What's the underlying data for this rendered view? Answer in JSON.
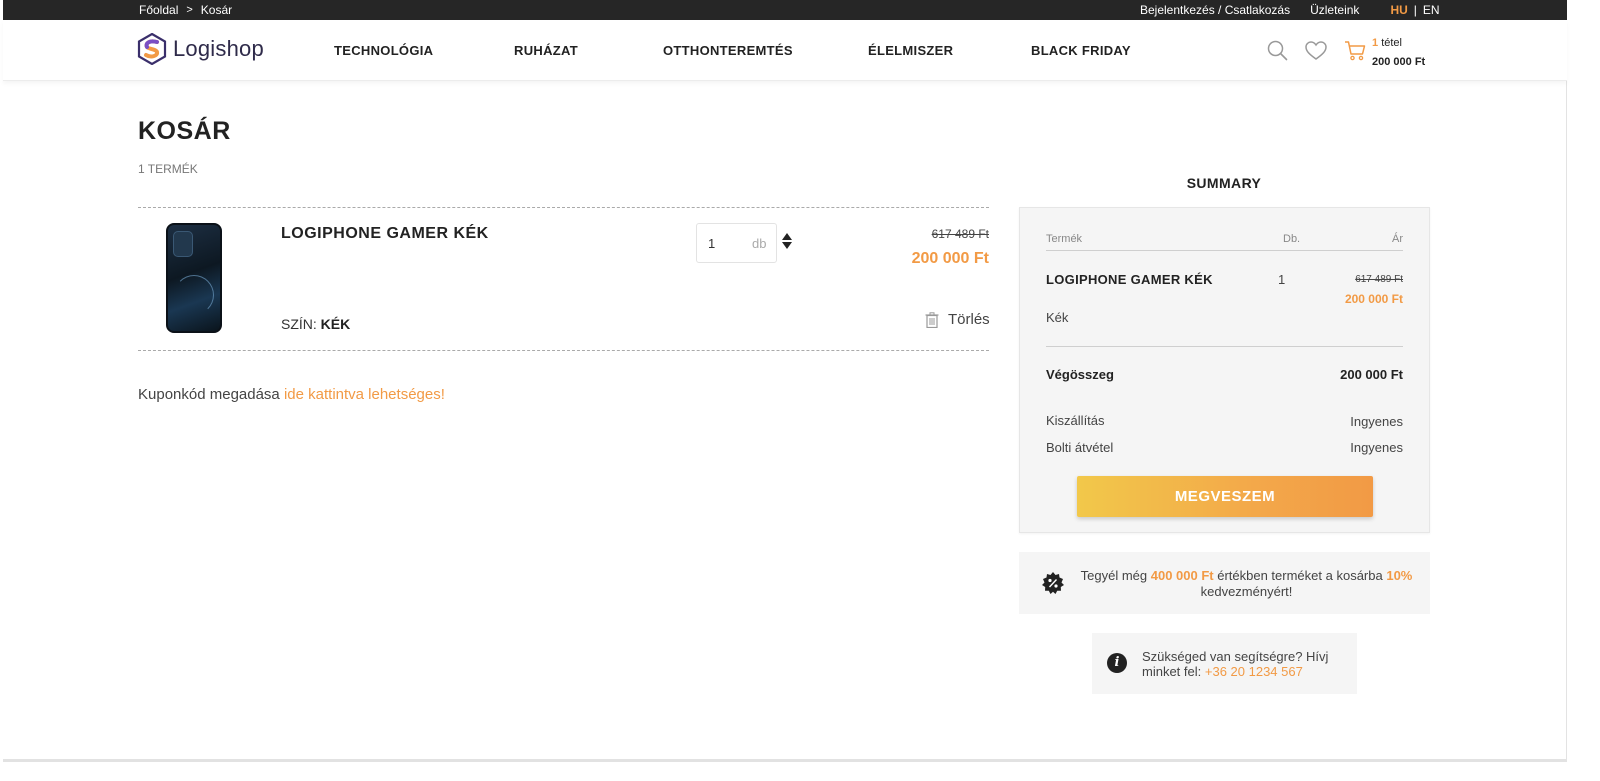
{
  "topbar": {
    "breadcrumb": [
      {
        "label": "Főoldal"
      },
      {
        "label": "Kosár"
      }
    ],
    "breadcrumb_sep": ">",
    "login": "Bejelentkezés / Csatlakozás",
    "stores": "Üzleteink",
    "lang_hu": "HU",
    "lang_sep": "|",
    "lang_en": "EN"
  },
  "header": {
    "logo_text": "Logishop",
    "nav": [
      "TECHNOLÓGIA",
      "RUHÁZAT",
      "OTTHONTEREMTÉS",
      "ÉLELMISZER",
      "BLACK FRIDAY"
    ],
    "icons": [
      "search-icon",
      "heart-icon",
      "cart-icon"
    ],
    "cart_count": "1",
    "cart_count_unit": "tétel",
    "cart_total": "200 000 Ft"
  },
  "cart": {
    "title": "KOSÁR",
    "item_count": "1 TERMÉK",
    "items": [
      {
        "name": "LOGIPHONE GAMER KÉK",
        "color_label": "SZÍN:",
        "color_value": "KÉK",
        "quantity": "1",
        "unit": "db",
        "old_price": "617 489 Ft",
        "price": "200 000 Ft",
        "delete_label": "Törlés"
      }
    ],
    "coupon_text": "Kuponkód megadása",
    "coupon_link": "ide kattintva lehetséges!"
  },
  "summary": {
    "title": "SUMMARY",
    "col_product": "Termék",
    "col_qty": "Db.",
    "col_price": "Ár",
    "item_name": "LOGIPHONE GAMER KÉK",
    "item_qty": "1",
    "item_old_price": "617 489 Ft",
    "item_price": "200 000 Ft",
    "item_variant": "Kék",
    "total_label": "Végösszeg",
    "total_value": "200 000 Ft",
    "shipping_label": "Kiszállítás",
    "shipping_value": "Ingyenes",
    "pickup_label": "Bolti átvétel",
    "pickup_value": "Ingyenes",
    "buy_button": "MEGVESZEM"
  },
  "promo": {
    "text_before": "Tegyél még",
    "amount": "400 000 Ft",
    "text_middle": "értékben terméket a kosárba",
    "percent": "10%",
    "text_after": "kedvezményért!"
  },
  "help": {
    "text": "Szükséged van segítségre? Hívj minket fel:",
    "phone": "+36 20 1234 567"
  },
  "colors": {
    "accent": "#f29a45",
    "topbar": "#262626",
    "panel": "#f5f5f5"
  }
}
